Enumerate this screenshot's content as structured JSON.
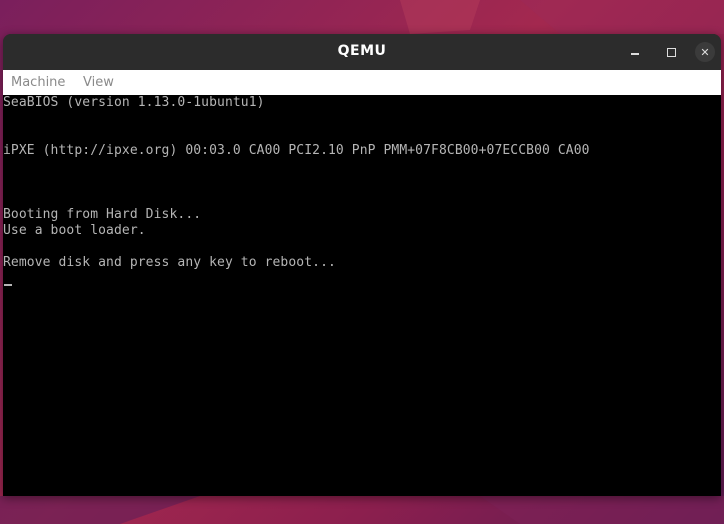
{
  "window": {
    "title": "QEMU"
  },
  "menu": {
    "items": [
      "Machine",
      "View"
    ]
  },
  "console": {
    "lines": [
      "SeaBIOS (version 1.13.0-1ubuntu1)",
      "iPXE (http://ipxe.org) 00:03.0 CA00 PCI2.10 PnP PMM+07F8CB00+07ECCB00 CA00",
      "Booting from Hard Disk...",
      "Use a boot loader.",
      "Remove disk and press any key to reboot..."
    ]
  },
  "colors": {
    "desktop_accent": "#a3284f",
    "titlebar": "#2c2c2c",
    "console_background": "#000000",
    "console_text": "#b5b5b5"
  },
  "icons": {
    "minimize": "minimize-icon",
    "maximize": "maximize-icon",
    "close": "close-icon"
  }
}
